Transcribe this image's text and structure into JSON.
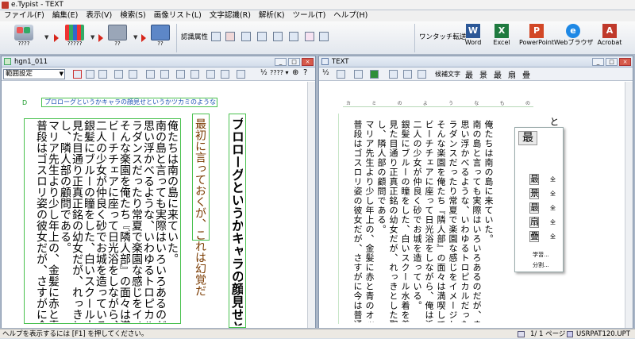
{
  "window": {
    "title": "e.Typist - TEXT"
  },
  "menubar": {
    "items": [
      "ファイル(F)",
      "編集(E)",
      "表示(V)",
      "検索(S)",
      "画像リスト(L)",
      "文字認識(R)",
      "解析(K)",
      "ツール(T)",
      "ヘルプ(H)"
    ]
  },
  "toolbar": {
    "big_buttons": [
      {
        "label": "????"
      },
      {
        "label": "?????"
      },
      {
        "label": "??"
      },
      {
        "label": "??"
      }
    ],
    "recog_attr": "認識属性",
    "one_touch": "ワンタッチ転送",
    "office": [
      {
        "label": "Word",
        "letter": "W",
        "color": "#2b5797"
      },
      {
        "label": "Excel",
        "letter": "X",
        "color": "#1f7a3f"
      },
      {
        "label": "PowerPoint",
        "letter": "P",
        "color": "#d24726"
      },
      {
        "label": "Webブラウザ",
        "letter": "e",
        "color": "#1e88e5"
      },
      {
        "label": "Acrobat",
        "letter": "A",
        "color": "#c0392b"
      }
    ]
  },
  "left_window": {
    "title": "hgn1_011",
    "select_value": "範囲設定",
    "fraction": "½",
    "zoom": "???? ▾",
    "heading": "プロローグというかキャラの顔見せというかツカ",
    "boxed_line": "最初に言っておくが、これは幻覚だ",
    "horizontal_line": "プロローグというかキャラの顔見せというかツカミのようなもの",
    "lines": [
      "俺たちは南の島に来ていた。",
      "南の島と言っても実際はいろいろあるのだが、まあそ",
      "思い浮かべるような、いわゆるトロピカルだったり綺麗",
      "ラダンスだったり常夏で楽園な感じをイメージしてもら",
      "そんな楽園を俺たち『隣人部』の面々は満喫していた。",
      "ビーチチェアに座って日光浴をしながら、俺は浜辺の",
      "二人の少女が仲良く砂でお城を造っている。",
      "銀髪にブルーの瞳をした、白いスクール水着を着た十",
      "見た目通り正真正銘の幼女だが、れっきとした聖クロ",
      "し、隣人部の顧問である。",
      "マリア先生より少し年上の、金髪に赤と青のオッドア",
      "普段はゴスロリ姿の彼女だが、さすがに今は普通の―"
    ]
  },
  "right_window": {
    "title": "TEXT",
    "fraction": "½",
    "candidate_label": "候補文字",
    "tool_glyphs": [
      "最",
      "景",
      "最",
      "扇",
      "疊"
    ],
    "ruler_chars": [
      "カ",
      "ミ",
      "の",
      "よ",
      "う",
      "な",
      "も",
      "の"
    ],
    "heading_partial": "というツカ",
    "lines": [
      "俺たちは南の島に来ていた。",
      "南の島と言っても実際はいろいろあるのだが、まあそ",
      "思い浮かべるような、いわゆるトロピカルだったり綺麗",
      "ラダンスだったり常夏で楽園な感じをイメージしてもら",
      "そんな楽園を俺たち『隣人部』の面々は満喫していた。",
      "ビーチチェアに座って日光浴をしながら、俺は浜辺の",
      "二人の少女が仲良く砂でお城を造っている。",
      "銀髪にブルーの瞳をした、白いスクール水着を着た十",
      "見た目通り正真正銘の幼女だが、れっきとした聖クロ",
      "し、隣人部の顧問である。",
      "マリア先生より少し年上の、金髪に赤と青のオッドア",
      "普段はゴスロリ姿の彼女だが、さすがに今は普通の―"
    ]
  },
  "popup": {
    "main": "最",
    "candidates": [
      {
        "k": "最",
        "n": "全"
      },
      {
        "k": "景",
        "n": "全"
      },
      {
        "k": "最",
        "n": "全"
      },
      {
        "k": "扇",
        "n": "全"
      },
      {
        "k": "疊",
        "n": "全"
      }
    ],
    "learn": "学習...",
    "split": "分割..."
  },
  "status": {
    "help": "ヘルプを表示するには [F1] を押してください。",
    "page": "1/ 1 ページ",
    "file": "USRPAT120.UPT"
  }
}
